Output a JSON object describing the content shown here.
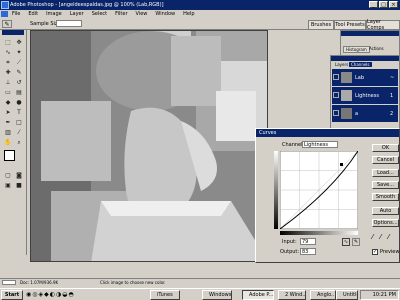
{
  "window": {
    "title": "Adobe Photoshop - [angeldeespaldas.jpg @ 100% (Lab,RGB)]",
    "controls": [
      "_",
      "□",
      "×"
    ]
  },
  "menu": [
    "File",
    "Edit",
    "Image",
    "Layer",
    "Select",
    "Filter",
    "View",
    "Window",
    "Help"
  ],
  "options_bar": {
    "sample_size_label": "Sample Size:",
    "tabs": [
      "Brushes",
      "Tool Presets",
      "Layer Comps"
    ]
  },
  "panels": {
    "navigator_tabs": [
      "Histogram",
      "Actions"
    ],
    "layers_tabs": [
      "Layers",
      "Channels"
    ],
    "channels": [
      {
        "name": "Lab",
        "shortcut": "~"
      },
      {
        "name": "Lightness",
        "shortcut": "1"
      },
      {
        "name": "a",
        "shortcut": "2"
      }
    ]
  },
  "curves": {
    "title": "Curves",
    "channel_label": "Channel:",
    "channel_value": "Lightness",
    "input_label": "Input:",
    "input_value": "79",
    "output_label": "Output:",
    "output_value": "83",
    "buttons": [
      "OK",
      "Cancel",
      "Load...",
      "Save...",
      "Smooth",
      "Auto",
      "Options..."
    ],
    "preview_label": "Preview",
    "preview_checked": true
  },
  "statusbar": {
    "doc_info": "Doc: 1.07M/936.9K",
    "hint": "Click image to choose new color."
  },
  "taskbar": {
    "start_label": "Start",
    "tasks": [
      {
        "label": "iTunes",
        "active": false
      },
      {
        "label": "Windows",
        "active": false
      },
      {
        "label": "Adobe P...",
        "active": true
      },
      {
        "label": "2 Wind...",
        "active": false
      },
      {
        "label": "Anglo..",
        "active": false
      },
      {
        "label": "Untitle...",
        "active": false
      }
    ],
    "clock": "10:21 PM"
  }
}
